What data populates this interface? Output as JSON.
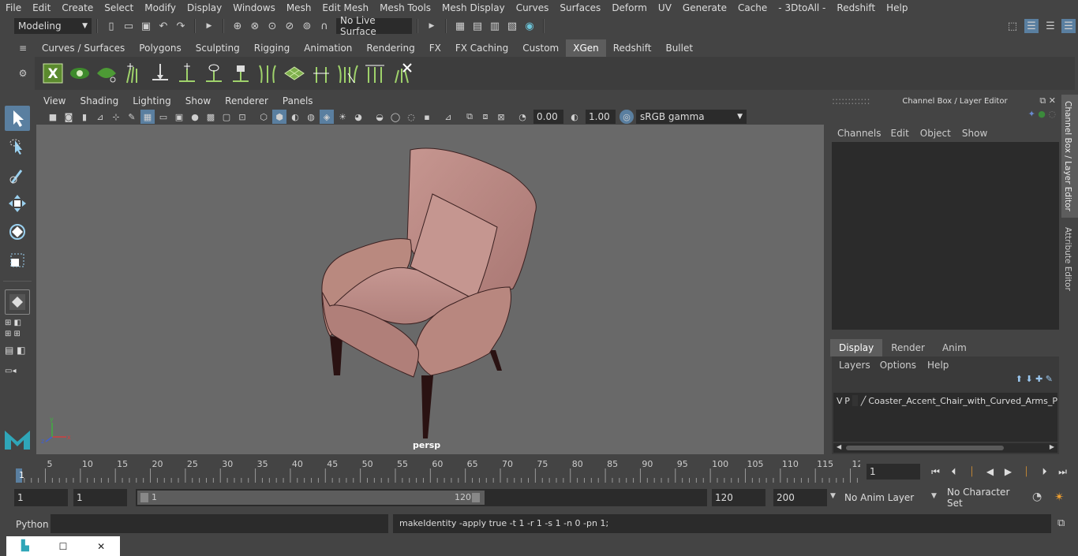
{
  "menu": [
    "File",
    "Edit",
    "Create",
    "Select",
    "Modify",
    "Display",
    "Windows",
    "Mesh",
    "Edit Mesh",
    "Mesh Tools",
    "Mesh Display",
    "Curves",
    "Surfaces",
    "Deform",
    "UV",
    "Generate",
    "Cache",
    "- 3DtoAll -",
    "Redshift",
    "Help"
  ],
  "status": {
    "mode": "Modeling",
    "live_surface": "No Live Surface"
  },
  "shelf_tabs": [
    "Curves / Surfaces",
    "Polygons",
    "Sculpting",
    "Rigging",
    "Animation",
    "Rendering",
    "FX",
    "FX Caching",
    "Custom",
    "XGen",
    "Redshift",
    "Bullet"
  ],
  "shelf_active": "XGen",
  "viewport": {
    "menu": [
      "View",
      "Shading",
      "Lighting",
      "Show",
      "Renderer",
      "Panels"
    ],
    "exposure": "0.00",
    "gamma": "1.00",
    "color_space": "sRGB gamma",
    "camera_label": "persp"
  },
  "channel_box": {
    "title": "Channel Box / Layer Editor",
    "menu": [
      "Channels",
      "Edit",
      "Object",
      "Show"
    ],
    "layer_tabs": [
      "Display",
      "Render",
      "Anim"
    ],
    "layer_menu": [
      "Layers",
      "Options",
      "Help"
    ],
    "layer": {
      "v": "V",
      "p": "P",
      "name": "Coaster_Accent_Chair_with_Curved_Arms_P"
    }
  },
  "side_tabs": [
    "Channel Box / Layer Editor",
    "Attribute Editor"
  ],
  "timeline": {
    "ticks": [
      "5",
      "10",
      "15",
      "20",
      "25",
      "30",
      "35",
      "40",
      "45",
      "50",
      "55",
      "60",
      "65",
      "70",
      "75",
      "80",
      "85",
      "90",
      "95",
      "100",
      "105",
      "110",
      "115",
      "12"
    ],
    "start_label": "1",
    "current_frame": "1"
  },
  "range": {
    "start": "1",
    "playback_start": "1",
    "slider_start": "1",
    "slider_end": "120",
    "playback_end": "120",
    "end": "200",
    "anim_layer": "No Anim Layer",
    "char_set": "No Character Set"
  },
  "command": {
    "lang": "Python",
    "result": "makeIdentity -apply true -t 1 -r 1 -s 1 -n 0 -pn 1;"
  },
  "colors": {
    "accent": "#5a7fa0",
    "chair": "#c08e88",
    "legs": "#2a1212",
    "viewport": "#696969"
  }
}
